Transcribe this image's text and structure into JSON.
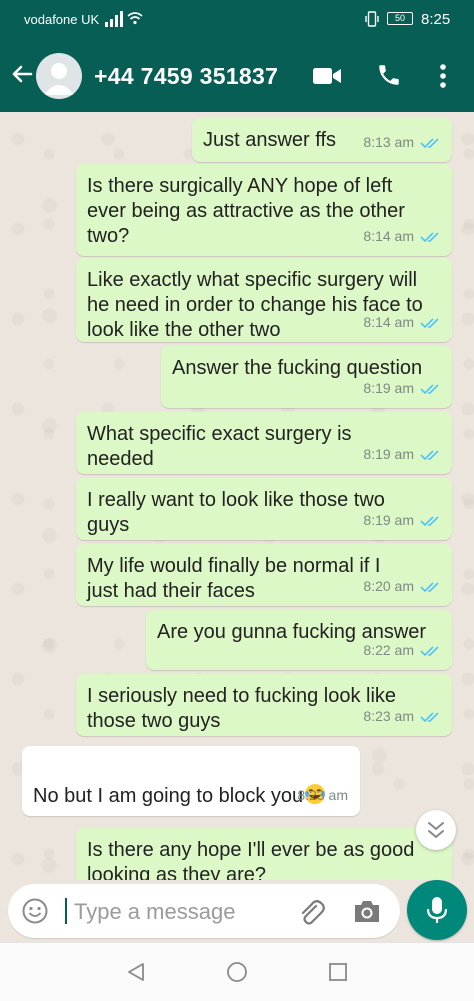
{
  "status_bar": {
    "carrier": "vodafone UK",
    "battery": "50",
    "time": "8:25"
  },
  "header": {
    "contact": "+44 7459 351837"
  },
  "messages": [
    {
      "dir": "out",
      "text": "Just answer ffs",
      "time": "8:13 am"
    },
    {
      "dir": "out",
      "text": "Is there surgically ANY hope of left\never being as attractive as the other\ntwo?",
      "time": "8:14 am"
    },
    {
      "dir": "out",
      "text": "Like exactly what specific surgery will\nhe need in order to change his face to\nlook like the other two",
      "time": "8:14 am"
    },
    {
      "dir": "out",
      "text": "Answer the fucking question",
      "time": "8:19 am"
    },
    {
      "dir": "out",
      "text": "What specific exact surgery is\nneeded",
      "time": "8:19 am"
    },
    {
      "dir": "out",
      "text": "I really want to look like those two\nguys",
      "time": "8:19 am"
    },
    {
      "dir": "out",
      "text": "My life would finally be normal if I\njust had their faces",
      "time": "8:20 am"
    },
    {
      "dir": "out",
      "text": "Are you gunna fucking answer",
      "time": "8:22 am"
    },
    {
      "dir": "out",
      "text": "I seriously need to fucking look like\nthose two guys",
      "time": "8:23 am"
    },
    {
      "dir": "in",
      "text": "No but I am going to block you",
      "emoji": "face-with-tears-of-joy",
      "time": "8:23 am"
    },
    {
      "dir": "out",
      "text": "Is there any hope I'll ever be as good\nlooking as they are?",
      "time": ""
    }
  ],
  "composer": {
    "placeholder": "Type a message"
  },
  "colors": {
    "header": "#075e54",
    "outgoing": "#dcf8c6",
    "incoming": "#ffffff",
    "tick": "#4fc3f7",
    "mic": "#00897b"
  }
}
